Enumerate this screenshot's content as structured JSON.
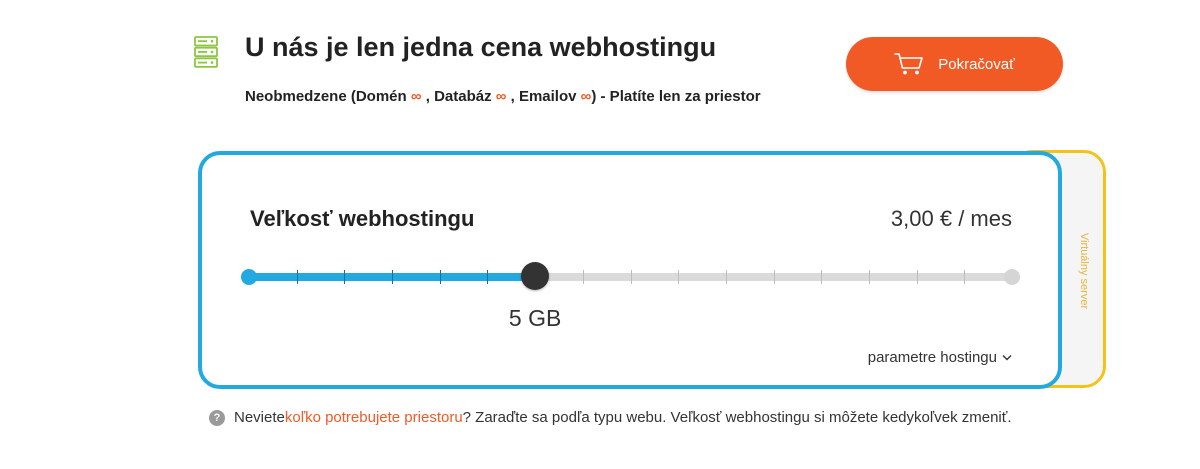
{
  "header": {
    "title": "U nás je len jedna cena webhostingu",
    "icon": "server-icon",
    "subtitle": {
      "part1": "Neobmedzene (Domén ",
      "part2": " , Databáz ",
      "part3": " , Emailov ",
      "part4": ") - Platíte len za priestor",
      "infinity": "∞"
    }
  },
  "continue_button": {
    "label": "Pokračovať",
    "icon": "cart-icon"
  },
  "hosting_card": {
    "title": "Veľkosť webhostingu",
    "price": "3,00 € / mes",
    "selected_size": "5 GB",
    "params_toggle": "parametre hostingu",
    "params_icon": "chevron-down-icon"
  },
  "slider": {
    "steps": 17,
    "selected_index": 6,
    "selected_fraction": 0.375
  },
  "vps_card": {
    "label": "Virtuálny server"
  },
  "help": {
    "icon": "question-icon",
    "icon_glyph": "?",
    "before": "Neviete ",
    "link": "koľko potrebujete priestoru",
    "after": "? Zaraďte sa podľa typu webu. Veľkosť webhostingu si môžete kedykoľvek zmeniť."
  },
  "colors": {
    "accent_orange": "#f15a24",
    "accent_blue": "#23a9e1",
    "vps_yellow": "#f2c318",
    "icon_green": "#8cc63f"
  }
}
